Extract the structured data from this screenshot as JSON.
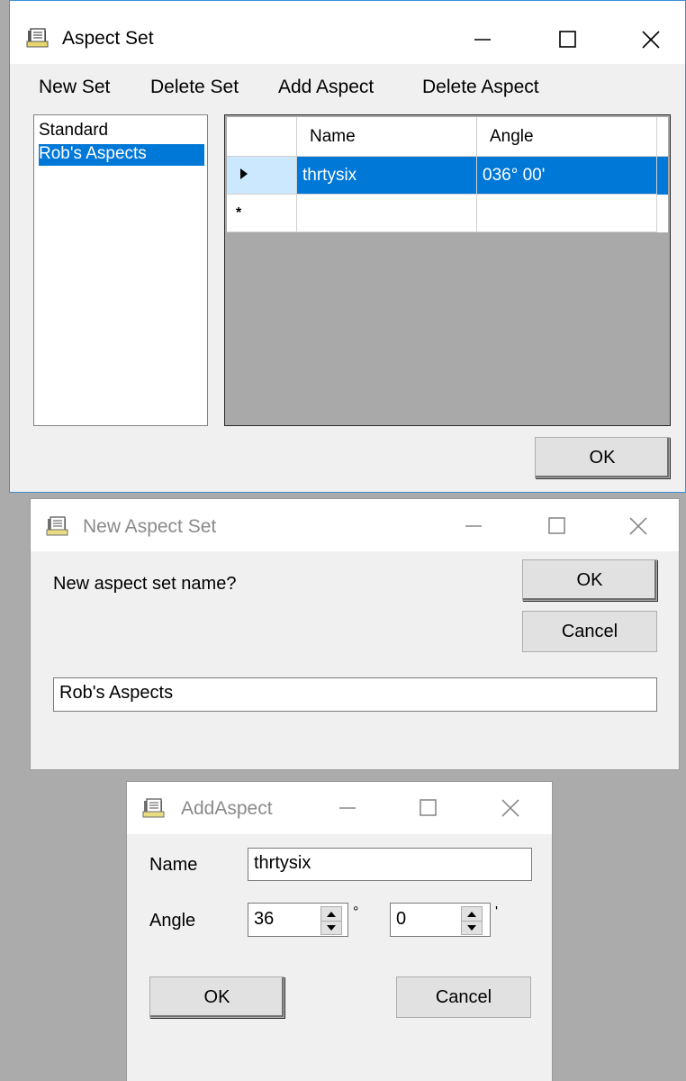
{
  "aspect_set": {
    "title": "Aspect Set",
    "menu": [
      "New Set",
      "Delete Set",
      "Add Aspect",
      "Delete Aspect"
    ],
    "sets": [
      "Standard",
      "Rob's Aspects"
    ],
    "selected_set_index": 1,
    "grid": {
      "columns": [
        "Name",
        "Angle"
      ],
      "rows": [
        {
          "name": "thrtysix",
          "angle": "036° 00'"
        }
      ],
      "new_row_marker": "*"
    },
    "ok_label": "OK"
  },
  "new_aspect_set": {
    "title": "New Aspect Set",
    "prompt": "New aspect set name?",
    "ok_label": "OK",
    "cancel_label": "Cancel",
    "name_value": "Rob's Aspects"
  },
  "add_aspect": {
    "title": "AddAspect",
    "name_label": "Name",
    "name_value": "thrtysix",
    "angle_label": "Angle",
    "degrees_value": "36",
    "degrees_unit": "°",
    "minutes_value": "0",
    "minutes_unit": "'",
    "ok_label": "OK",
    "cancel_label": "Cancel"
  },
  "colors": {
    "selection": "#0078d7",
    "window_bg": "#f0f0f0",
    "desktop": "#ababab",
    "grid_bg": "#a9a9a9"
  },
  "icons": [
    "notebook-icon",
    "minimize-icon",
    "maximize-icon",
    "close-icon",
    "row-arrow-icon",
    "new-row-icon",
    "spin-up-icon",
    "spin-down-icon"
  ]
}
